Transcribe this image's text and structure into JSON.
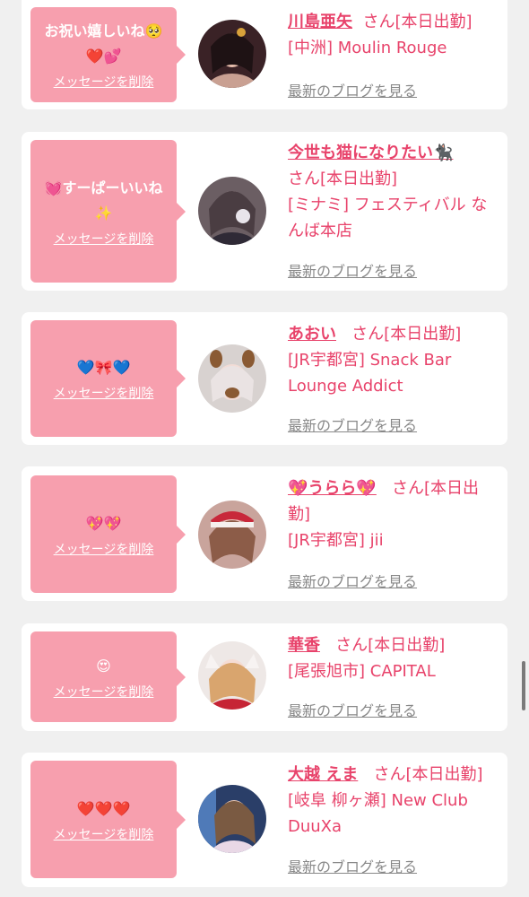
{
  "delete_label": "メッセージを削除",
  "blog_label": "最新のブログを見る",
  "cards": [
    {
      "message": "お祝い嬉しいね🥺",
      "message2": "❤️💕",
      "name": "川島亜矢",
      "suffix": "さん[本日出勤]",
      "shop": "[中洲] Moulin Rouge"
    },
    {
      "message": "💓すーぱーいいね",
      "message2": "✨",
      "name": "今世も猫になりたい🐈‍⬛",
      "suffix": "さん[本日出勤]",
      "shop": "[ミナミ] フェスティバル なんば本店"
    },
    {
      "message": "💙🎀💙",
      "message2": "",
      "name": "あおい",
      "suffix": "さん[本日出勤]",
      "shop": "[JR宇都宮] Snack Bar Lounge Addict"
    },
    {
      "message": "💖💖",
      "message2": "",
      "name": "💖うらら💖",
      "suffix": "さん[本日出勤]",
      "shop": "[JR宇都宮] jii"
    },
    {
      "message": "😍",
      "message2": "",
      "name": "華香",
      "suffix": "さん[本日出勤]",
      "shop": "[尾張旭市] CAPITAL"
    },
    {
      "message": "❤️❤️❤️",
      "message2": "",
      "name": "大越 えま",
      "suffix": "さん[本日出勤]",
      "shop": "[岐阜 柳ヶ瀬] New Club DuuXa"
    }
  ],
  "colors": {
    "accent": "#e8436b",
    "bubble": "#f79fae",
    "background": "#f0f0f0"
  },
  "icons": {
    "avatar": "avatar-photo-icon"
  }
}
